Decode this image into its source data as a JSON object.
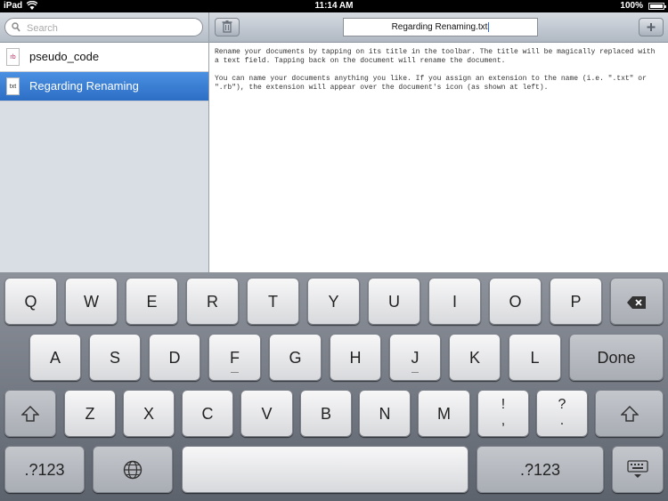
{
  "status_bar": {
    "carrier": "iPad",
    "time": "11:14 AM",
    "battery": "100%"
  },
  "sidebar": {
    "search_placeholder": "Search",
    "documents": [
      {
        "label": "pseudo_code",
        "icon_text": "rb",
        "icon": "rb-document-icon",
        "selected": false
      },
      {
        "label": "Regarding Renaming",
        "icon_text": "txt",
        "icon": "txt-document-icon",
        "selected": true
      }
    ]
  },
  "editor": {
    "title": "Regarding Renaming.txt",
    "paragraphs": [
      "Rename your documents by tapping on its title in the toolbar. The title will be magically replaced with a text field. Tapping back on the document will rename the document.",
      "You can name your documents anything you like. If you assign an extension to the name (i.e. \".txt\" or \".rb\"), the extension will appear over the document's icon (as shown at left)."
    ]
  },
  "keyboard": {
    "row1": [
      "Q",
      "W",
      "E",
      "R",
      "T",
      "Y",
      "U",
      "I",
      "O",
      "P"
    ],
    "row2": [
      "A",
      "S",
      "D",
      "F",
      "G",
      "H",
      "J",
      "K",
      "L"
    ],
    "done_label": "Done",
    "row3": [
      "Z",
      "X",
      "C",
      "V",
      "B",
      "N",
      "M"
    ],
    "punct1_top": "!",
    "punct1_bottom": ",",
    "punct2_top": "?",
    "punct2_bottom": ".",
    "numbers_label": ".?123"
  }
}
